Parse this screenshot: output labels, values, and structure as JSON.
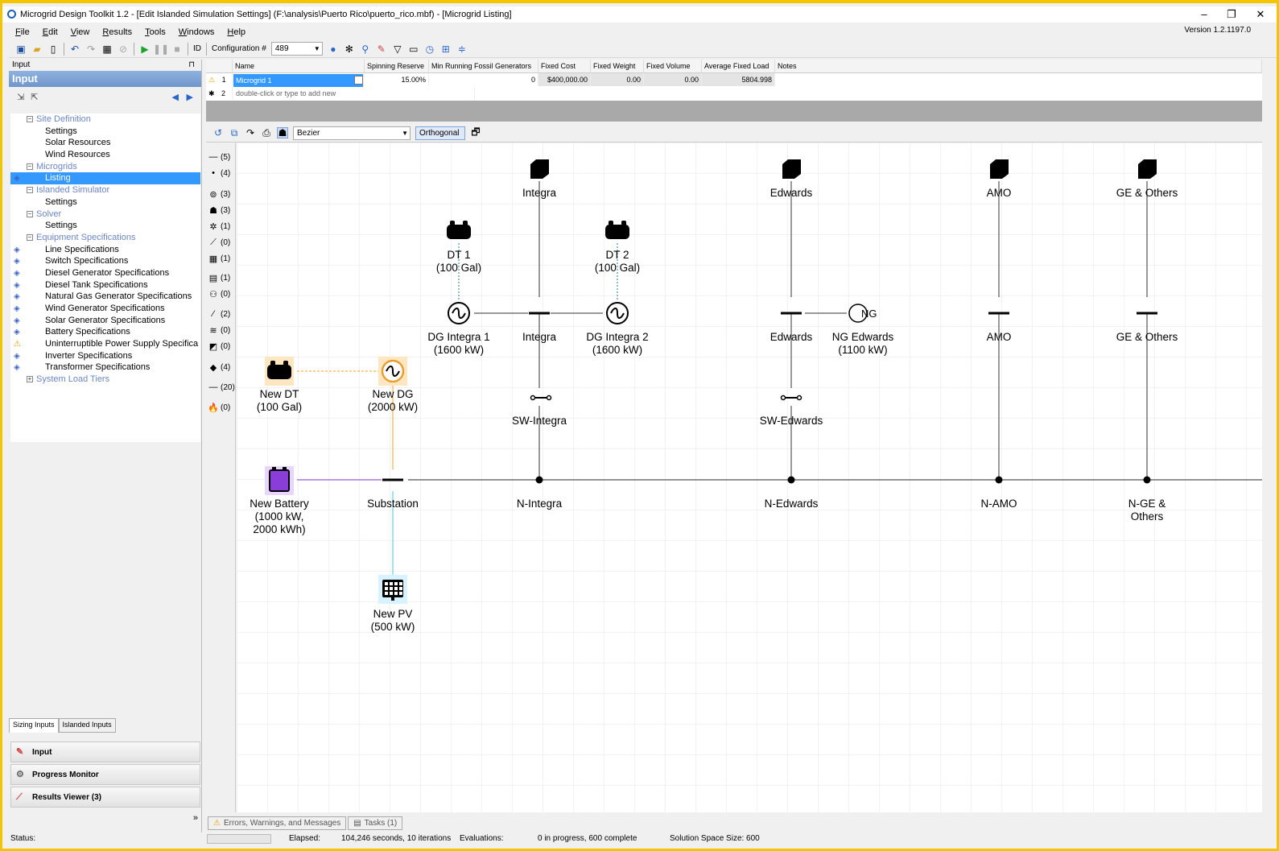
{
  "window": {
    "title": "Microgrid Design Toolkit 1.2 - [Edit Islanded Simulation Settings] (F:\\analysis\\Puerto Rico\\puerto_rico.mbf) - [Microgrid Listing]",
    "version": "Version 1.2.1197.0",
    "minimize": "–",
    "restore": "❐",
    "close": "✕"
  },
  "menu": [
    "File",
    "Edit",
    "View",
    "Results",
    "Tools",
    "Windows",
    "Help"
  ],
  "toolbar": {
    "id_label": "ID",
    "config_label": "Configuration #",
    "config_value": "489"
  },
  "left_panel": {
    "header": "Input",
    "title": "Input",
    "pin": "⊓",
    "tree": [
      {
        "type": "cat",
        "label": "Site Definition"
      },
      {
        "type": "leaf",
        "label": "Settings"
      },
      {
        "type": "leaf",
        "label": "Solar Resources"
      },
      {
        "type": "leaf",
        "label": "Wind Resources"
      },
      {
        "type": "cat",
        "label": "Microgrids"
      },
      {
        "type": "leaf",
        "label": "Listing",
        "selected": true,
        "mark": "info"
      },
      {
        "type": "cat",
        "label": "Islanded Simulator"
      },
      {
        "type": "leaf",
        "label": "Settings"
      },
      {
        "type": "cat",
        "label": "Solver"
      },
      {
        "type": "leaf",
        "label": "Settings"
      },
      {
        "type": "cat",
        "label": "Equipment Specifications"
      },
      {
        "type": "leaf",
        "label": "Line Specifications",
        "mark": "info"
      },
      {
        "type": "leaf",
        "label": "Switch Specifications",
        "mark": "info"
      },
      {
        "type": "leaf",
        "label": "Diesel Generator Specifications",
        "mark": "info"
      },
      {
        "type": "leaf",
        "label": "Diesel Tank Specifications",
        "mark": "info"
      },
      {
        "type": "leaf",
        "label": "Natural Gas Generator Specifications",
        "mark": "info"
      },
      {
        "type": "leaf",
        "label": "Wind Generator Specifications",
        "mark": "info"
      },
      {
        "type": "leaf",
        "label": "Solar Generator Specifications",
        "mark": "info"
      },
      {
        "type": "leaf",
        "label": "Battery Specifications",
        "mark": "info"
      },
      {
        "type": "leaf",
        "label": "Uninterruptible Power Supply Specifica",
        "mark": "warn"
      },
      {
        "type": "leaf",
        "label": "Inverter Specifications",
        "mark": "info"
      },
      {
        "type": "leaf",
        "label": "Transformer Specifications",
        "mark": "info"
      },
      {
        "type": "cat",
        "label": "System Load Tiers",
        "collapsed": true
      }
    ],
    "tabs": [
      "Sizing Inputs",
      "Islanded Inputs"
    ],
    "nav": [
      "Input",
      "Progress Monitor",
      "Results Viewer (3)"
    ]
  },
  "grid": {
    "headers": [
      "Name",
      "Spinning Reserve",
      "Min Running Fossil Generators",
      "Fixed Cost",
      "Fixed Weight",
      "Fixed Volume",
      "Average Fixed Load",
      "Notes"
    ],
    "row1": {
      "num": "1",
      "name": "Microgrid 1",
      "spinning": "15.00%",
      "minrun": "0",
      "cost": "$400,000.00",
      "weight": "0.00",
      "volume": "0.00",
      "load": "5804.998"
    },
    "row2": {
      "num": "2",
      "placeholder": "double-click or type to add new"
    }
  },
  "diagram_toolbar": {
    "curve": "Bezier",
    "routing": "Orthogonal"
  },
  "palette": [
    "(5)",
    "(4)",
    "(3)",
    "(3)",
    "(1)",
    "(0)",
    "(1)",
    "(1)",
    "(0)",
    "(2)",
    "(0)",
    "(0)",
    "(4)",
    "(20)",
    "(0)"
  ],
  "diagram": {
    "labels": {
      "integra_top": "Integra",
      "edwards_top": "Edwards",
      "amo_top": "AMO",
      "ge_top": "GE & Others",
      "dt1": "DT 1\n(100 Gal)",
      "dt2": "DT 2\n(100 Gal)",
      "dg1": "DG Integra 1\n(1600 kW)",
      "integra_bus": "Integra",
      "dg2": "DG Integra 2\n(1600 kW)",
      "edwards_bus": "Edwards",
      "ng": "NG Edwards\n(1100 kW)",
      "amo_bus": "AMO",
      "ge_bus": "GE & Others",
      "newdt": "New DT\n(100 Gal)",
      "newdg": "New DG\n(2000 kW)",
      "sw_integra": "SW-Integra",
      "sw_edwards": "SW-Edwards",
      "battery": "New Battery\n(1000 kW,\n2000 kWh)",
      "substation": "Substation",
      "n_integra": "N-Integra",
      "n_edwards": "N-Edwards",
      "n_amo": "N-AMO",
      "n_ge": "N-GE &\nOthers",
      "pv": "New PV\n(500 kW)",
      "ng_glyph": "NG"
    },
    "colors": {
      "orange": "#f7a21b",
      "purple": "#8a3dd8",
      "cyan": "#44c8e8",
      "highlight_orange": "#fde6c0",
      "highlight_purple": "#e9d6ff",
      "highlight_cyan": "#d6f3ff"
    }
  },
  "bottom_tabs": [
    "Errors, Warnings, and Messages",
    "Tasks (1)"
  ],
  "status": {
    "label": "Status:",
    "elapsed_label": "Elapsed:",
    "elapsed": "104,246 seconds, 10 iterations",
    "eval_label": "Evaluations:",
    "eval": "0 in progress, 600 complete",
    "space": "Solution Space Size:  600"
  }
}
